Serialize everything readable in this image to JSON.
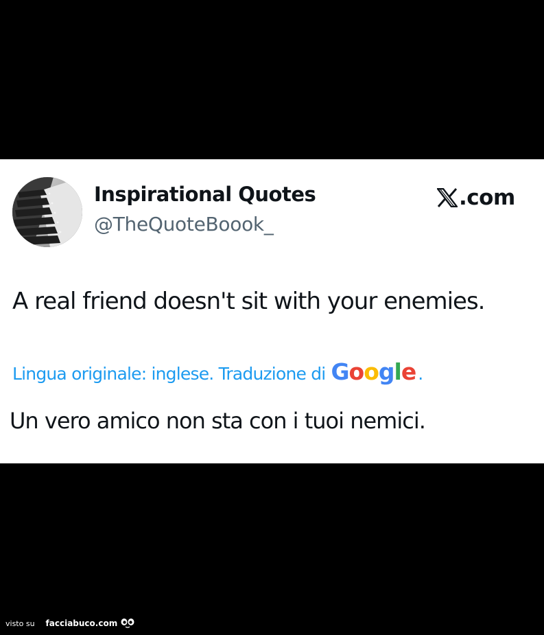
{
  "tweet": {
    "author": {
      "display_name": "Inspirational Quotes",
      "handle": "@TheQuoteBoook_"
    },
    "brand": {
      "logo": "x-logo-icon",
      "text": ".com"
    },
    "text": "A real friend doesn't sit with your enemies.",
    "translation": {
      "label": "Lingua originale: inglese. Traduzione di",
      "provider_logo": "Google",
      "trailing": ".",
      "text": "Un vero amico non sta con i tuoi nemici."
    }
  },
  "footer": {
    "prefix": "visto su",
    "site": "facciabuco.com"
  },
  "colors": {
    "background": "#000000",
    "card": "#ffffff",
    "link": "#1d9bf0",
    "text": "#0f1419",
    "secondary": "#536471"
  }
}
